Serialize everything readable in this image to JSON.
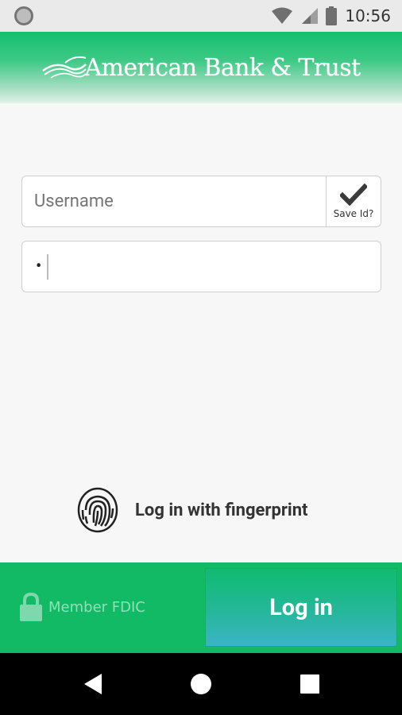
{
  "status_bar": {
    "time": "10:56",
    "icons": [
      "notification-circle-icon",
      "wifi-icon",
      "cell-signal-icon",
      "battery-icon"
    ]
  },
  "header": {
    "brand": "American Bank & Trust",
    "logo_icon": "flag-swoosh-icon"
  },
  "login_form": {
    "username_placeholder": "Username",
    "username_value": "",
    "save_id_label": "Save Id?",
    "save_id_checked": true,
    "password_value": "•"
  },
  "fingerprint": {
    "label": "Log in with fingerprint",
    "icon": "fingerprint-icon"
  },
  "footer": {
    "fdic_label": "Member FDIC",
    "fdic_icon": "lock-icon",
    "login_label": "Log in"
  },
  "nav_bar": {
    "icons": [
      "back-icon",
      "home-icon",
      "recents-icon"
    ]
  },
  "colors": {
    "brand_green": "#12ba66",
    "login_teal": "#3bb4c6",
    "background": "#f7f7f7"
  }
}
